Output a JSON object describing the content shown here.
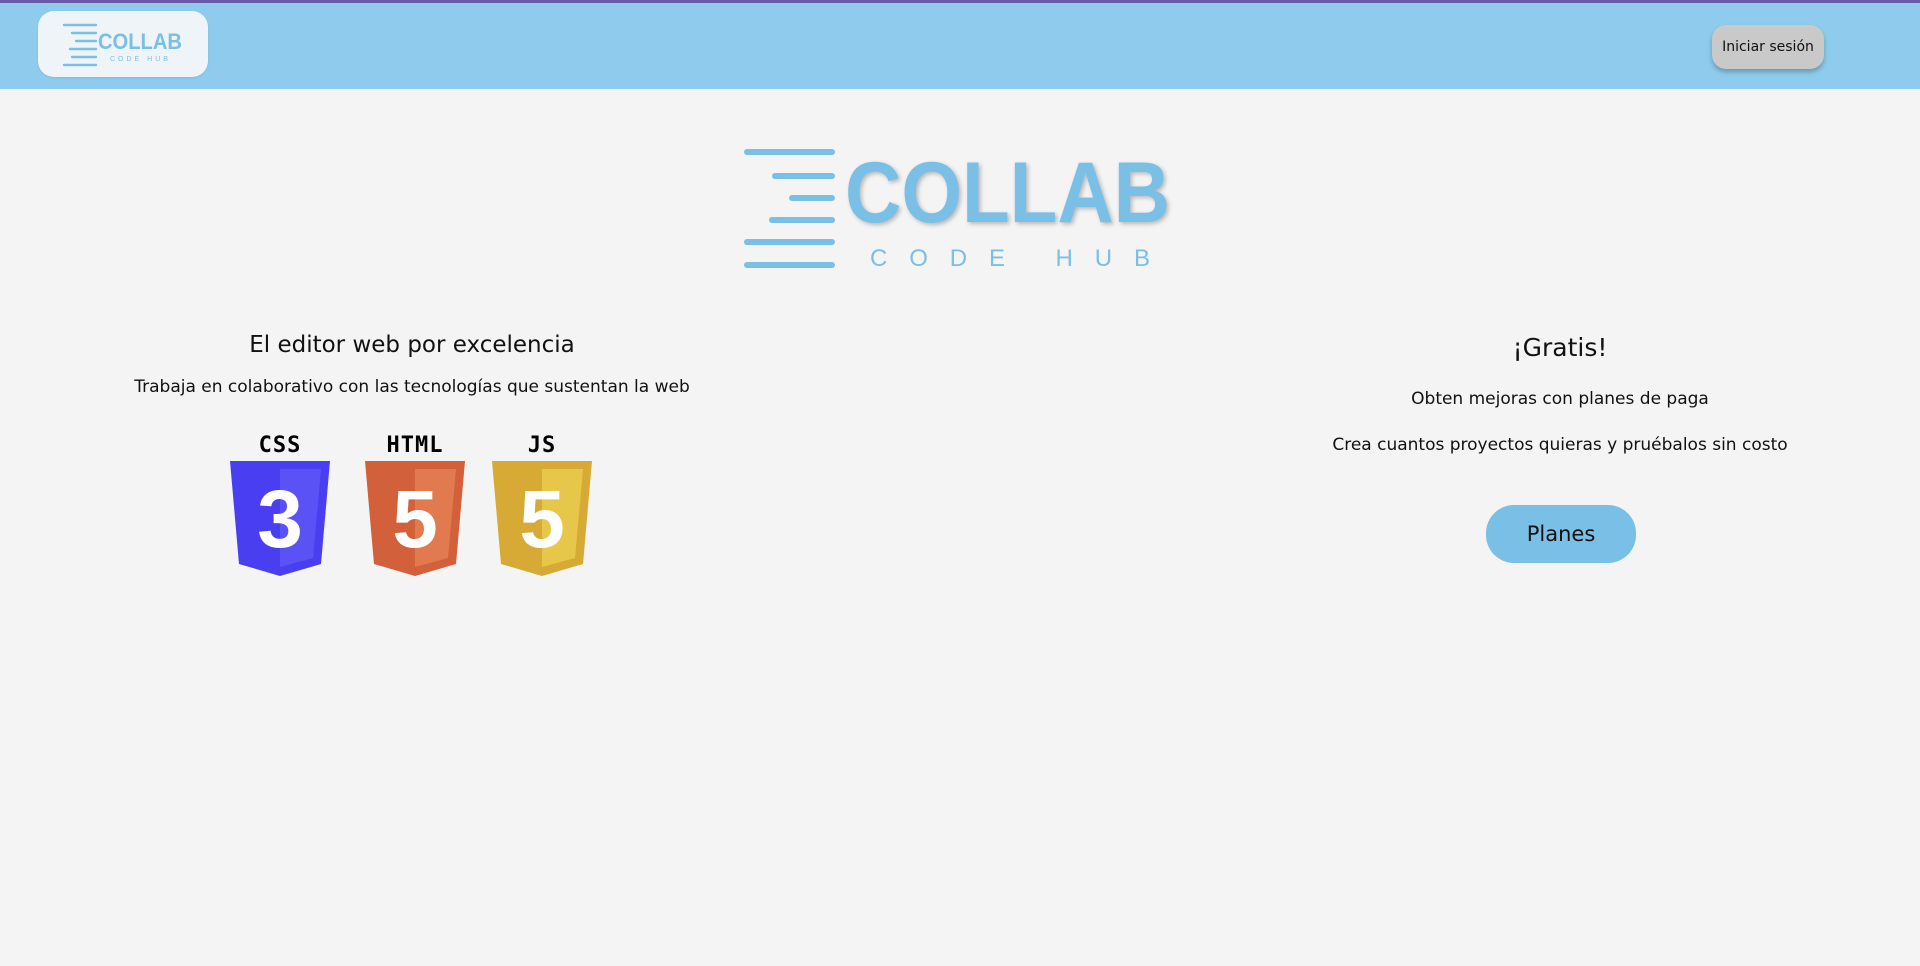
{
  "header": {
    "logo_text": "COLLAB",
    "logo_subtext": "CODE HUB",
    "login_label": "Iniciar sesión"
  },
  "hero": {
    "logo_text": "COLLAB",
    "logo_subtext": "CODE HUB"
  },
  "left": {
    "title": "El editor web por excelencia",
    "subtitle": "Trabaja en colaborativo con las tecnologías que sustentan la web",
    "techs": [
      {
        "label": "CSS",
        "number": "3",
        "color": "#4a3ff0",
        "light": "#5a52f5"
      },
      {
        "label": "HTML",
        "number": "5",
        "color": "#d2603a",
        "light": "#e17a4f"
      },
      {
        "label": "JS",
        "number": "5",
        "color": "#d6aa35",
        "light": "#e7c74a"
      }
    ]
  },
  "right": {
    "title": "¡Gratis!",
    "line1": "Obten mejoras con planes de paga",
    "line2": "Crea cuantos proyectos quieras y pruébalos sin costo",
    "plans_label": "Planes"
  },
  "colors": {
    "header_bg": "#8ecbec",
    "brand_blue": "#79bfe6",
    "page_bg": "#f4f4f4",
    "top_line": "#6a5aa8"
  }
}
